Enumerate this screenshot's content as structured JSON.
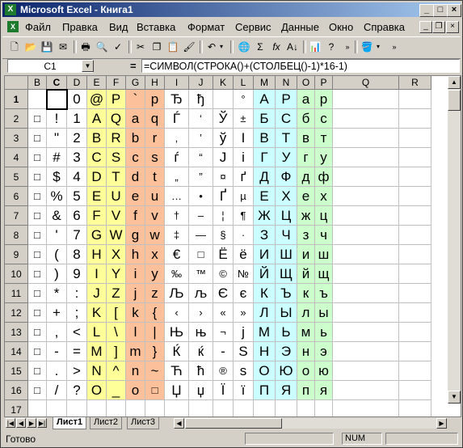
{
  "title": "Microsoft Excel - Книга1",
  "app_icon": "excel-icon",
  "menu": [
    "Файл",
    "Правка",
    "Вид",
    "Вставка",
    "Формат",
    "Сервис",
    "Данные",
    "Окно",
    "Справка"
  ],
  "formula_bar": {
    "name_box": "C1",
    "equals": "=",
    "formula": "=СИМВОЛ(СТРОКА()+(СТОЛБЕЦ()-1)*16-1)"
  },
  "columns": [
    "B",
    "C",
    "D",
    "E",
    "F",
    "G",
    "H",
    "I",
    "J",
    "K",
    "L",
    "M",
    "N",
    "O",
    "P",
    "Q",
    "R"
  ],
  "rows": [
    "1",
    "2",
    "3",
    "4",
    "5",
    "6",
    "7",
    "8",
    "9",
    "10",
    "11",
    "12",
    "13",
    "14",
    "15",
    "16",
    "17"
  ],
  "fill_colors": {
    "yellow": "#ffff99",
    "orange": "#fcc09a",
    "cyan": "#ccffff",
    "green": "#ccffcc"
  },
  "cells": {
    "B": [
      "",
      "□",
      "□",
      "□",
      "□",
      "□",
      "□",
      "□",
      "□",
      "□",
      "□",
      "□",
      "□",
      "□",
      "□",
      "□",
      ""
    ],
    "C": [
      "",
      "!",
      "\"",
      "#",
      "$",
      "%",
      "&",
      "'",
      "(",
      ")",
      "*",
      "+",
      ",",
      "-",
      ".",
      "/",
      ""
    ],
    "D": [
      "0",
      "1",
      "2",
      "3",
      "4",
      "5",
      "6",
      "7",
      "8",
      "9",
      ":",
      ";",
      "<",
      "=",
      ">",
      "?",
      ""
    ],
    "E": [
      "@",
      "A",
      "B",
      "C",
      "D",
      "E",
      "F",
      "G",
      "H",
      "I",
      "J",
      "K",
      "L",
      "M",
      "N",
      "O",
      ""
    ],
    "F": [
      "P",
      "Q",
      "R",
      "S",
      "T",
      "U",
      "V",
      "W",
      "X",
      "Y",
      "Z",
      "[",
      "\\",
      "]",
      "^",
      "_",
      ""
    ],
    "G": [
      "`",
      "a",
      "b",
      "c",
      "d",
      "e",
      "f",
      "g",
      "h",
      "i",
      "j",
      "k",
      "l",
      "m",
      "n",
      "o",
      ""
    ],
    "H": [
      "p",
      "q",
      "r",
      "s",
      "t",
      "u",
      "v",
      "w",
      "x",
      "y",
      "z",
      "{",
      "|",
      "}",
      "~",
      "□",
      ""
    ],
    "I": [
      "Ђ",
      "Ѓ",
      "‚",
      "ѓ",
      "„",
      "…",
      "†",
      "‡",
      "€",
      "‰",
      "Љ",
      "‹",
      "Њ",
      "Ќ",
      "Ћ",
      "Џ",
      ""
    ],
    "J": [
      "ђ",
      "‘",
      "’",
      "“",
      "”",
      "•",
      "–",
      "—",
      "□",
      "™",
      "љ",
      "›",
      "њ",
      "ќ",
      "ћ",
      "џ",
      ""
    ],
    "K": [
      "",
      "Ў",
      "ў",
      "Ј",
      "¤",
      "Ґ",
      "¦",
      "§",
      "Ё",
      "©",
      "Є",
      "«",
      "¬",
      "-",
      "®",
      "Ї",
      ""
    ],
    "L": [
      "°",
      "±",
      "І",
      "і",
      "ґ",
      "µ",
      "¶",
      "·",
      "ё",
      "№",
      "є",
      "»",
      "ј",
      "Ѕ",
      "ѕ",
      "ї",
      ""
    ],
    "M": [
      "А",
      "Б",
      "В",
      "Г",
      "Д",
      "Е",
      "Ж",
      "З",
      "И",
      "Й",
      "К",
      "Л",
      "М",
      "Н",
      "О",
      "П",
      ""
    ],
    "N": [
      "Р",
      "С",
      "Т",
      "У",
      "Ф",
      "Х",
      "Ц",
      "Ч",
      "Ш",
      "Щ",
      "Ъ",
      "Ы",
      "Ь",
      "Э",
      "Ю",
      "Я",
      ""
    ],
    "O": [
      "а",
      "б",
      "в",
      "г",
      "д",
      "е",
      "ж",
      "з",
      "и",
      "й",
      "к",
      "л",
      "м",
      "н",
      "о",
      "п",
      ""
    ],
    "P": [
      "р",
      "с",
      "т",
      "у",
      "ф",
      "х",
      "ц",
      "ч",
      "ш",
      "щ",
      "ъ",
      "ы",
      "ь",
      "э",
      "ю",
      "я",
      ""
    ],
    "Q": [
      "",
      "",
      "",
      "",
      "",
      "",
      "",
      "",
      "",
      "",
      "",
      "",
      "",
      "",
      "",
      "",
      ""
    ],
    "R": [
      "",
      "",
      "",
      "",
      "",
      "",
      "",
      "",
      "",
      "",
      "",
      "",
      "",
      "",
      "",
      "",
      ""
    ]
  },
  "sheets": [
    "Лист1",
    "Лист2",
    "Лист3"
  ],
  "status": {
    "ready": "Готово",
    "num": "NUM"
  }
}
